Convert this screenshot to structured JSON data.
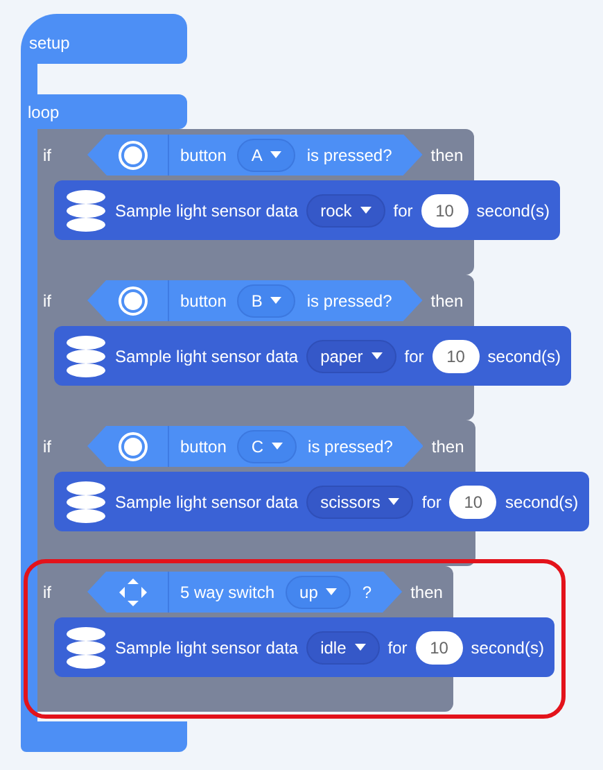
{
  "hat": {
    "label": "setup"
  },
  "loop": {
    "label": "loop",
    "blocks": [
      {
        "if_label": "if",
        "then_label": "then",
        "highlighted": false,
        "condition": {
          "kind": "button",
          "parts": [
            {
              "kind": "text",
              "text": "button"
            },
            {
              "kind": "dropdown",
              "text": "A"
            },
            {
              "kind": "text",
              "text": "is pressed?"
            }
          ]
        },
        "action": {
          "parts": [
            {
              "kind": "text",
              "text": "Sample light sensor data"
            },
            {
              "kind": "dropdown",
              "text": "rock"
            },
            {
              "kind": "text",
              "text": "for"
            },
            {
              "kind": "number",
              "text": "10"
            },
            {
              "kind": "text",
              "text": "second(s)"
            }
          ]
        }
      },
      {
        "if_label": "if",
        "then_label": "then",
        "highlighted": false,
        "condition": {
          "kind": "button",
          "parts": [
            {
              "kind": "text",
              "text": "button"
            },
            {
              "kind": "dropdown",
              "text": "B"
            },
            {
              "kind": "text",
              "text": "is pressed?"
            }
          ]
        },
        "action": {
          "parts": [
            {
              "kind": "text",
              "text": "Sample light sensor data"
            },
            {
              "kind": "dropdown",
              "text": "paper"
            },
            {
              "kind": "text",
              "text": "for"
            },
            {
              "kind": "number",
              "text": "10"
            },
            {
              "kind": "text",
              "text": "second(s)"
            }
          ]
        }
      },
      {
        "if_label": "if",
        "then_label": "then",
        "highlighted": false,
        "condition": {
          "kind": "button",
          "parts": [
            {
              "kind": "text",
              "text": "button"
            },
            {
              "kind": "dropdown",
              "text": "C"
            },
            {
              "kind": "text",
              "text": "is pressed?"
            }
          ]
        },
        "action": {
          "parts": [
            {
              "kind": "text",
              "text": "Sample light sensor data"
            },
            {
              "kind": "dropdown",
              "text": "scissors"
            },
            {
              "kind": "text",
              "text": "for"
            },
            {
              "kind": "number",
              "text": "10"
            },
            {
              "kind": "text",
              "text": "second(s)"
            }
          ]
        }
      },
      {
        "if_label": "if",
        "then_label": "then",
        "highlighted": true,
        "condition": {
          "kind": "switch",
          "parts": [
            {
              "kind": "text",
              "text": "5 way switch"
            },
            {
              "kind": "dropdown",
              "text": "up"
            },
            {
              "kind": "text",
              "text": "?"
            }
          ]
        },
        "action": {
          "parts": [
            {
              "kind": "text",
              "text": "Sample light sensor data"
            },
            {
              "kind": "dropdown",
              "text": "idle"
            },
            {
              "kind": "text",
              "text": "for"
            },
            {
              "kind": "number",
              "text": "10"
            },
            {
              "kind": "text",
              "text": "second(s)"
            }
          ]
        }
      }
    ]
  }
}
